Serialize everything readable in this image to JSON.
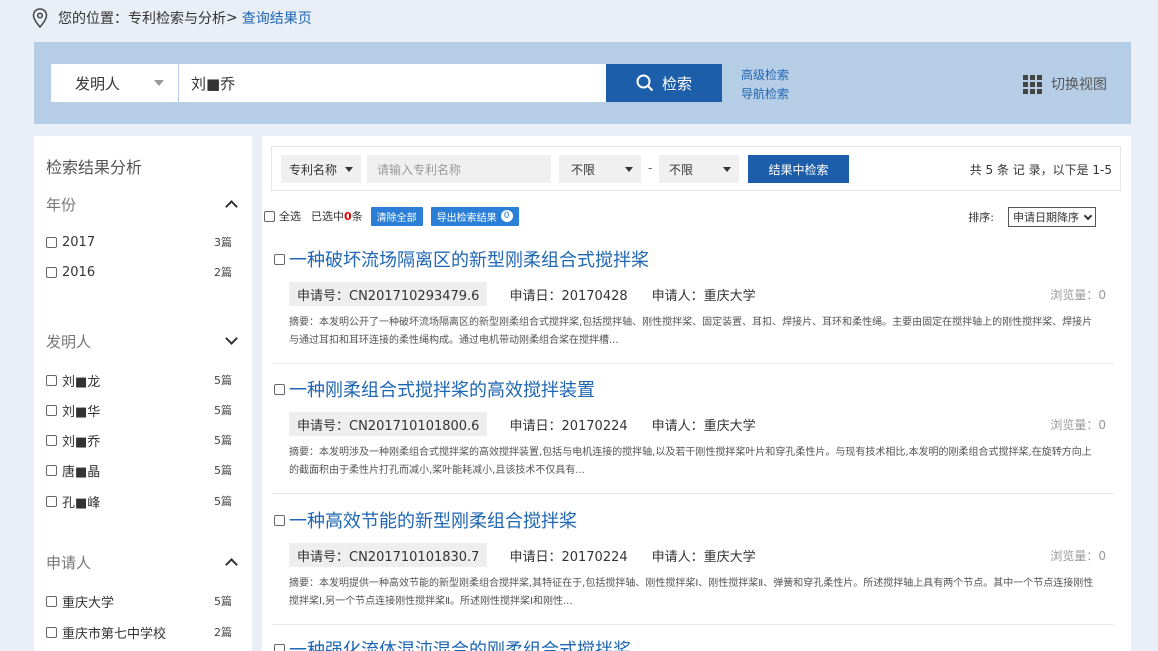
{
  "breadcrumb": {
    "prefix": "您的位置：",
    "path": "专利检索与分析",
    "separator": ">",
    "current": "查询结果页"
  },
  "search": {
    "field": "发明人",
    "query": "刘■乔",
    "button": "检索",
    "advanced_link": "高级检索",
    "nav_link": "导航检索",
    "switch_view": "切换视图"
  },
  "sidebar": {
    "title": "检索结果分析",
    "year": {
      "label": "年份",
      "items": [
        {
          "label": "2017",
          "count": "3篇"
        },
        {
          "label": "2016",
          "count": "2篇"
        }
      ]
    },
    "inventor": {
      "label": "发明人",
      "items": [
        {
          "label": "刘■龙",
          "count": "5篇"
        },
        {
          "label": "刘■华",
          "count": "5篇"
        },
        {
          "label": "刘■乔",
          "count": "5篇"
        },
        {
          "label": "唐■晶",
          "count": "5篇"
        },
        {
          "label": "孔■峰",
          "count": "5篇"
        }
      ]
    },
    "applicant": {
      "label": "申请人",
      "items": [
        {
          "label": "重庆大学",
          "count": "5篇"
        },
        {
          "label": "重庆市第七中学校",
          "count": "2篇"
        }
      ]
    }
  },
  "filter": {
    "field": "专利名称",
    "placeholder": "请输入专利名称",
    "from": "不限",
    "dash": "-",
    "to": "不限",
    "button": "结果中检索",
    "total": "共 5 条 记 录，以下是 1-5"
  },
  "bulk": {
    "select_all": "全选",
    "selected_prefix": "已选中",
    "selected_count": "0",
    "selected_suffix": "条",
    "clear": "清除全部",
    "export": "导出检索结果",
    "export_badge": "0",
    "sort_label": "排序:",
    "sort_value": "申请日期降序"
  },
  "results": [
    {
      "title": "一种破坏流场隔离区的新型刚柔组合式搅拌桨",
      "app_no": "申请号：CN201710293479.6",
      "app_date": "申请日：20170428",
      "applicant": "申请人：重庆大学",
      "views": "浏览量：0",
      "abstract": "摘要：本发明公开了一种破坏流场隔离区的新型刚柔组合式搅拌桨,包括搅拌轴、刚性搅拌桨、固定装置、耳扣、焊接片、耳环和柔性绳。主要由固定在搅拌轴上的刚性搅拌桨、焊接片与通过耳扣和耳环连接的柔性绳构成。通过电机带动刚柔组合桨在搅拌槽..."
    },
    {
      "title": "一种刚柔组合式搅拌桨的高效搅拌装置",
      "app_no": "申请号：CN201710101800.6",
      "app_date": "申请日：20170224",
      "applicant": "申请人：重庆大学",
      "views": "浏览量：0",
      "abstract": "摘要：本发明涉及一种刚柔组合式搅拌桨的高效搅拌装置,包括与电机连接的搅拌轴,以及若干刚性搅拌桨叶片和穿孔柔性片。与现有技术相比,本发明的刚柔组合式搅拌桨,在旋转方向上的截面积由于柔性片打孔而减小,桨叶能耗减小,且该技术不仅具有..."
    },
    {
      "title": "一种高效节能的新型刚柔组合搅拌桨",
      "app_no": "申请号：CN201710101830.7",
      "app_date": "申请日：20170224",
      "applicant": "申请人：重庆大学",
      "views": "浏览量：0",
      "abstract": "摘要：本发明提供一种高效节能的新型刚柔组合搅拌桨,其特征在于,包括搅拌轴、刚性搅拌桨Ⅰ、刚性搅拌桨Ⅱ、弹簧和穿孔柔性片。所述搅拌轴上具有两个节点。其中一个节点连接刚性搅拌桨Ⅰ,另一个节点连接刚性搅拌桨Ⅱ。所述刚性搅拌桨Ⅰ和刚性..."
    }
  ],
  "partial_result_title": "一种强化流体混沌混合的刚柔组合式搅拌桨"
}
